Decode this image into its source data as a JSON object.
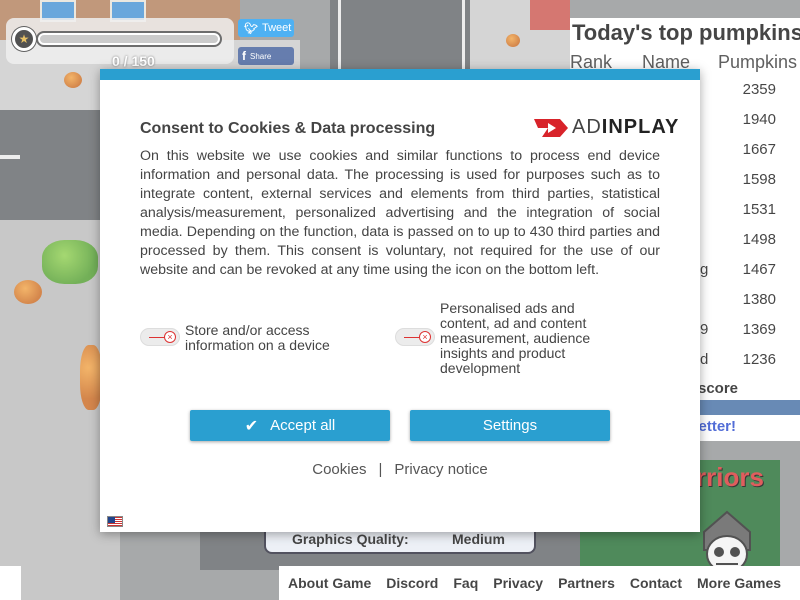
{
  "game": {
    "progress": {
      "current": 0,
      "goal": 150,
      "text": "0 / 150"
    },
    "social": {
      "tweet_label": "Tweet",
      "share_label": "Share"
    },
    "leaderboard": {
      "title": "Today's top pumpkins:",
      "headers": {
        "rank": "Rank",
        "name": "Name",
        "pumpkins": "Pumpkins"
      },
      "rows": [
        {
          "name": "",
          "score": "2359"
        },
        {
          "name": "",
          "score": "1940"
        },
        {
          "name": "",
          "score": "1667"
        },
        {
          "name": "",
          "score": "1598"
        },
        {
          "name": "",
          "score": "1531"
        },
        {
          "name": "",
          "score": "1498"
        },
        {
          "name": "g",
          "score": "1467"
        },
        {
          "name": "",
          "score": "1380"
        },
        {
          "name": "9",
          "score": "1369"
        },
        {
          "name": "d",
          "score": "1236"
        }
      ],
      "your_score_label": "score",
      "do_better_text": "o better!"
    },
    "ad": {
      "title": "rriors"
    },
    "graphics": {
      "label": "Graphics Quality:",
      "value": "Medium"
    },
    "bottom_nav": [
      "About Game",
      "Discord",
      "Faq",
      "Privacy",
      "Partners",
      "Contact",
      "More Games"
    ]
  },
  "consent": {
    "title": "Consent to Cookies & Data processing",
    "logo": {
      "ad": "AD",
      "inplay": "INPLAY"
    },
    "body": "On this website we use cookies and similar functions to process end device information and personal data. The processing is used for purposes such as to integrate content, external services and elements from third parties, statistical analysis/measurement, personalized advertising and the integration of social media. Depending on the function, data is passed on to up to 430 third parties and processed by them. This consent is voluntary, not required for the use of our website and can be revoked at any time using the icon on the bottom left.",
    "purposes": {
      "store": "Store and/or access information on a device",
      "ads": "Personalised ads and content, ad and content measurement, audience insights and product development"
    },
    "buttons": {
      "accept": "Accept all",
      "settings": "Settings"
    },
    "links": {
      "cookies": "Cookies",
      "separator": "|",
      "privacy": "Privacy notice"
    },
    "colors": {
      "accent": "#2a9fd0",
      "toggle_off": "#dd3333",
      "logo_red": "#d8232a"
    }
  }
}
